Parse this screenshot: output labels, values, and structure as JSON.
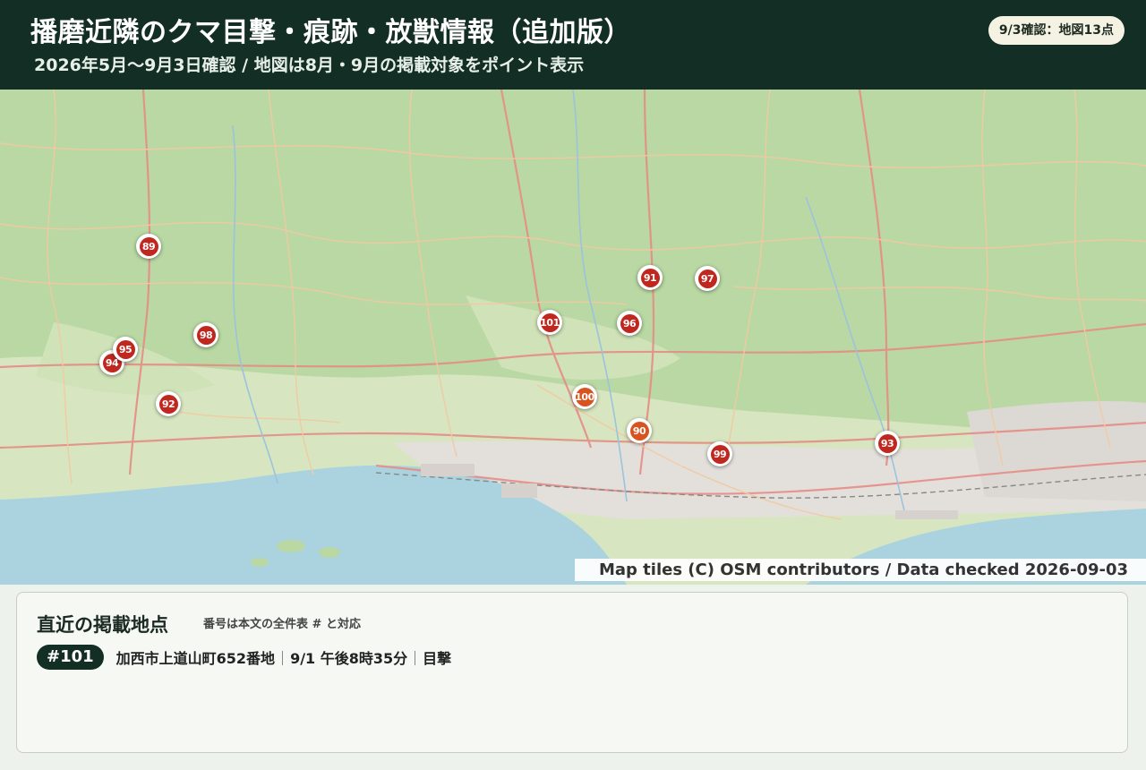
{
  "header": {
    "title": "播磨近隣のクマ目撃・痕跡・放獣情報（追加版）",
    "subtitle": "2026年5月〜9月3日確認 / 地図は8月・9月の掲載対象をポイント表示",
    "badge": "9/3確認：地図13点"
  },
  "map": {
    "attribution": "Map tiles (C) OSM contributors / Data checked 2026-09-03",
    "markers": [
      "89",
      "91",
      "97",
      "101",
      "96",
      "98",
      "95",
      "94",
      "92",
      "100",
      "90",
      "99",
      "93"
    ]
  },
  "panel": {
    "title": "直近の掲載地点",
    "note": "番号は本文の全件表 # と対応",
    "entry": {
      "number": "#101",
      "place": "加西市上道山町652番地",
      "datetime": "9/1 午後8時35分",
      "type": "目撃"
    }
  },
  "colors": {
    "header_bg": "#132e24",
    "marker_red": "#c0271f",
    "marker_orange": "#d9531e",
    "land": "#b8d8a4",
    "sea": "#a9d0e0"
  }
}
